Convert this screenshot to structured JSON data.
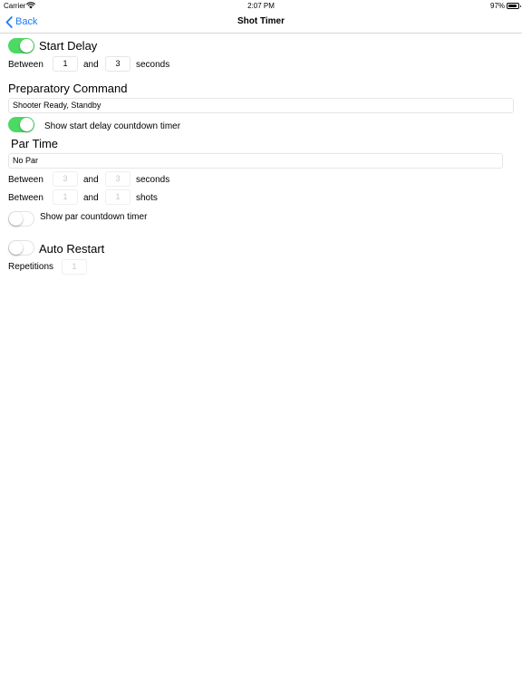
{
  "status_bar": {
    "carrier": "Carrier",
    "time": "2:07 PM",
    "battery": "97%"
  },
  "nav": {
    "back_label": "Back",
    "title": "Shot Timer"
  },
  "start_delay": {
    "label": "Start Delay",
    "enabled": true,
    "between_label": "Between",
    "min": "1",
    "and_label": "and",
    "max": "3",
    "unit_label": "seconds"
  },
  "preparatory_command": {
    "label": "Preparatory Command",
    "value": "Shooter Ready, Standby",
    "countdown_label": "Show start delay countdown timer",
    "countdown_enabled": true
  },
  "par_time": {
    "label": "Par Time",
    "value": "No Par",
    "seconds_row": {
      "between_label": "Between",
      "min": "3",
      "and_label": "and",
      "max": "3",
      "unit_label": "seconds"
    },
    "shots_row": {
      "between_label": "Between",
      "min": "1",
      "and_label": "and",
      "max": "1",
      "unit_label": "shots"
    },
    "countdown_label": "Show par countdown timer",
    "countdown_enabled": false
  },
  "auto_restart": {
    "label": "Auto Restart",
    "enabled": false,
    "repetitions_label": "Repetitions",
    "repetitions": "1"
  },
  "colors": {
    "accent": "#1a7cf4",
    "toggle_on": "#4cd964"
  }
}
